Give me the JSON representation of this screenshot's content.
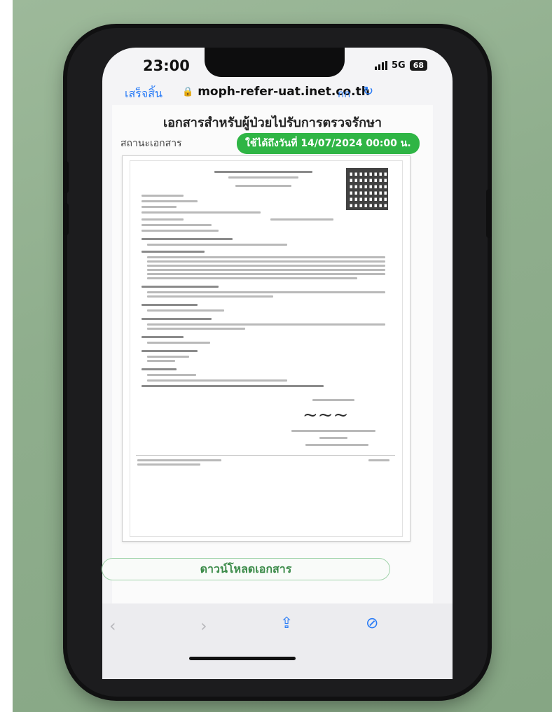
{
  "status_bar": {
    "time": "23:00",
    "network": "5G",
    "battery": "68"
  },
  "browser": {
    "done_label": "เสร็จสิ้น",
    "url": "moph-refer-uat.inet.co.th",
    "text_size_label": "กก"
  },
  "page": {
    "title": "เอกสารสำหรับผู้ป่วยไปรับการตรวจรักษา",
    "status_label": "สถานะเอกสาร",
    "valid_until": "ใช้ได้ถึงวันที่ 14/07/2024 00:00 น.",
    "download_label": "ดาวน์โหลดเอกสาร"
  },
  "colors": {
    "accent": "#2a7cf6",
    "valid_green": "#2fb545",
    "download_green": "#3a8a48"
  },
  "icons": {
    "lock": "lock-icon",
    "reload": "reload-icon",
    "back": "chevron-left-icon",
    "forward": "chevron-right-icon",
    "share": "share-icon",
    "compass": "compass-icon"
  }
}
